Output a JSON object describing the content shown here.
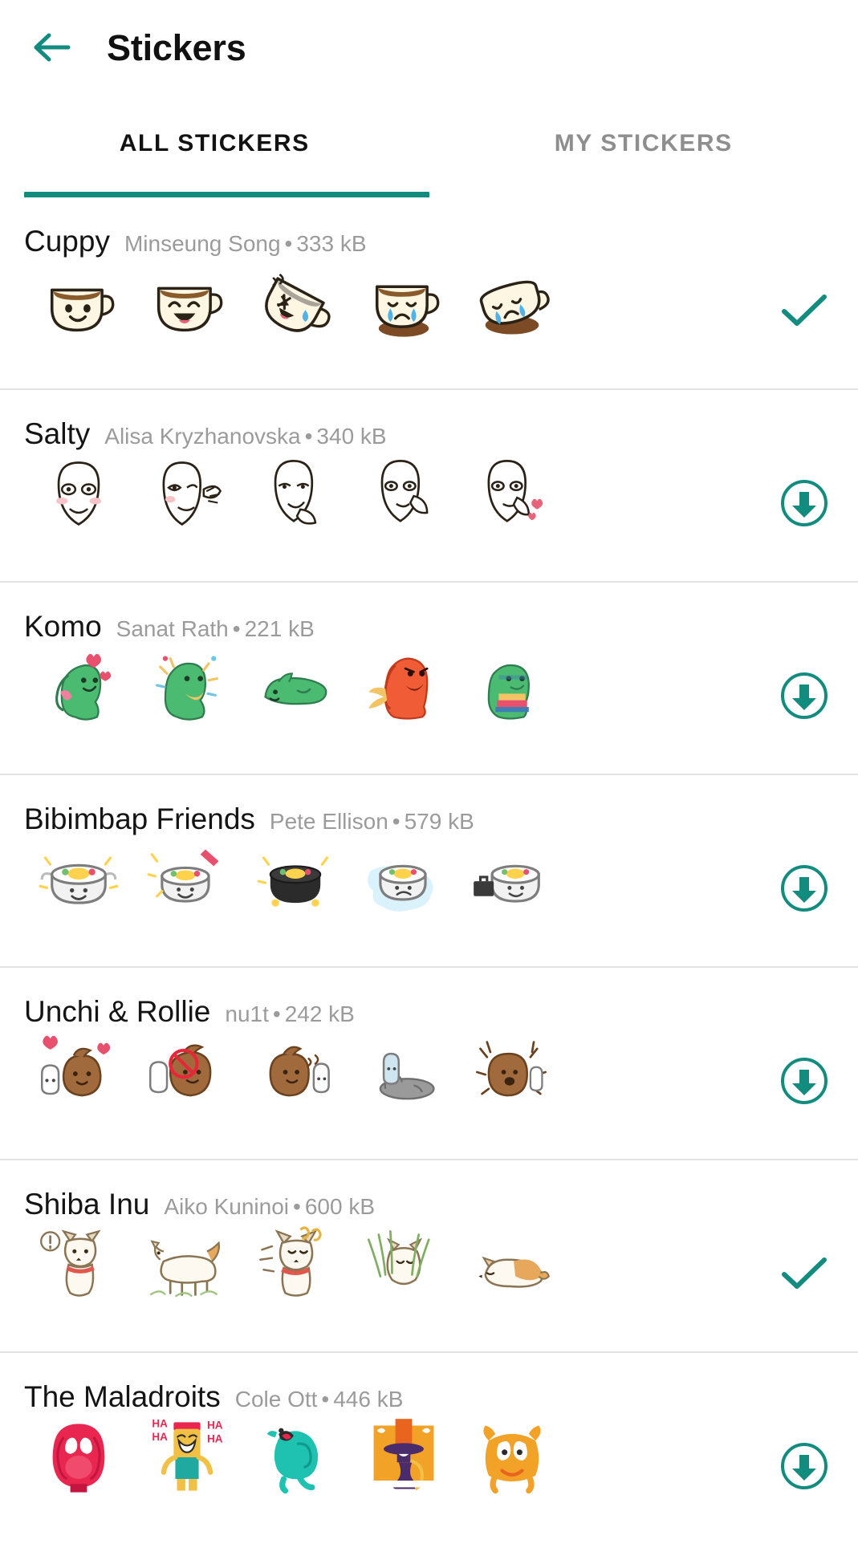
{
  "theme": {
    "accent": "#128C7E",
    "title_color": "#111111",
    "meta_color": "#9b9b9b",
    "divider": "#e3e3e3",
    "background": "#ffffff"
  },
  "appbar": {
    "back_icon": "arrow-left-icon",
    "title": "Stickers"
  },
  "tabs": [
    {
      "label": "ALL STICKERS",
      "active": true
    },
    {
      "label": "MY STICKERS",
      "active": false
    }
  ],
  "packs": [
    {
      "name": "Cuppy",
      "author": "Minseung Song",
      "separator": "•",
      "size": "333 kB",
      "action": "check-icon",
      "action_state": "downloaded",
      "stickers": [
        "cup-smile",
        "cup-laugh",
        "cup-spilling",
        "cup-crying",
        "cup-fallen"
      ]
    },
    {
      "name": "Salty",
      "author": "Alisa Kryzhanovska",
      "separator": "•",
      "size": "340 kB",
      "action": "download-icon",
      "action_state": "available",
      "stickers": [
        "face-blush",
        "face-wave",
        "face-smirk",
        "face-whisper",
        "face-hearts"
      ]
    },
    {
      "name": "Komo",
      "author": "Sanat Rath",
      "separator": "•",
      "size": "221 kB",
      "action": "download-icon",
      "action_state": "available",
      "stickers": [
        "dino-love",
        "dino-party",
        "dino-lying",
        "dino-angry-red",
        "dino-reading"
      ]
    },
    {
      "name": "Bibimbap Friends",
      "author": "Pete Ellison",
      "separator": "•",
      "size": "579 kB",
      "action": "download-icon",
      "action_state": "available",
      "stickers": [
        "bibimbap-happy",
        "bibimbap-excited",
        "bibimbap-dark",
        "bibimbap-cold",
        "bibimbap-briefcase"
      ]
    },
    {
      "name": "Unchi & Rollie",
      "author": "nu1t",
      "separator": "•",
      "size": "242 kB",
      "action": "download-icon",
      "action_state": "available",
      "stickers": [
        "unchi-love",
        "unchi-no",
        "unchi-talk",
        "unchi-sleep",
        "unchi-shock"
      ]
    },
    {
      "name": "Shiba Inu",
      "author": "Aiko Kuninoi",
      "separator": "•",
      "size": "600 kB",
      "action": "check-icon",
      "action_state": "downloaded",
      "stickers": [
        "shiba-alert",
        "shiba-walk",
        "shiba-confused",
        "shiba-grass",
        "shiba-sleeping"
      ]
    },
    {
      "name": "The Maladroits",
      "author": "Cole Ott",
      "separator": "•",
      "size": "446 kB",
      "action": "download-icon",
      "action_state": "available",
      "stickers": [
        "maladroit-pink",
        "maladroit-haha",
        "maladroit-teal",
        "maladroit-orange",
        "maladroit-yellow"
      ]
    }
  ]
}
